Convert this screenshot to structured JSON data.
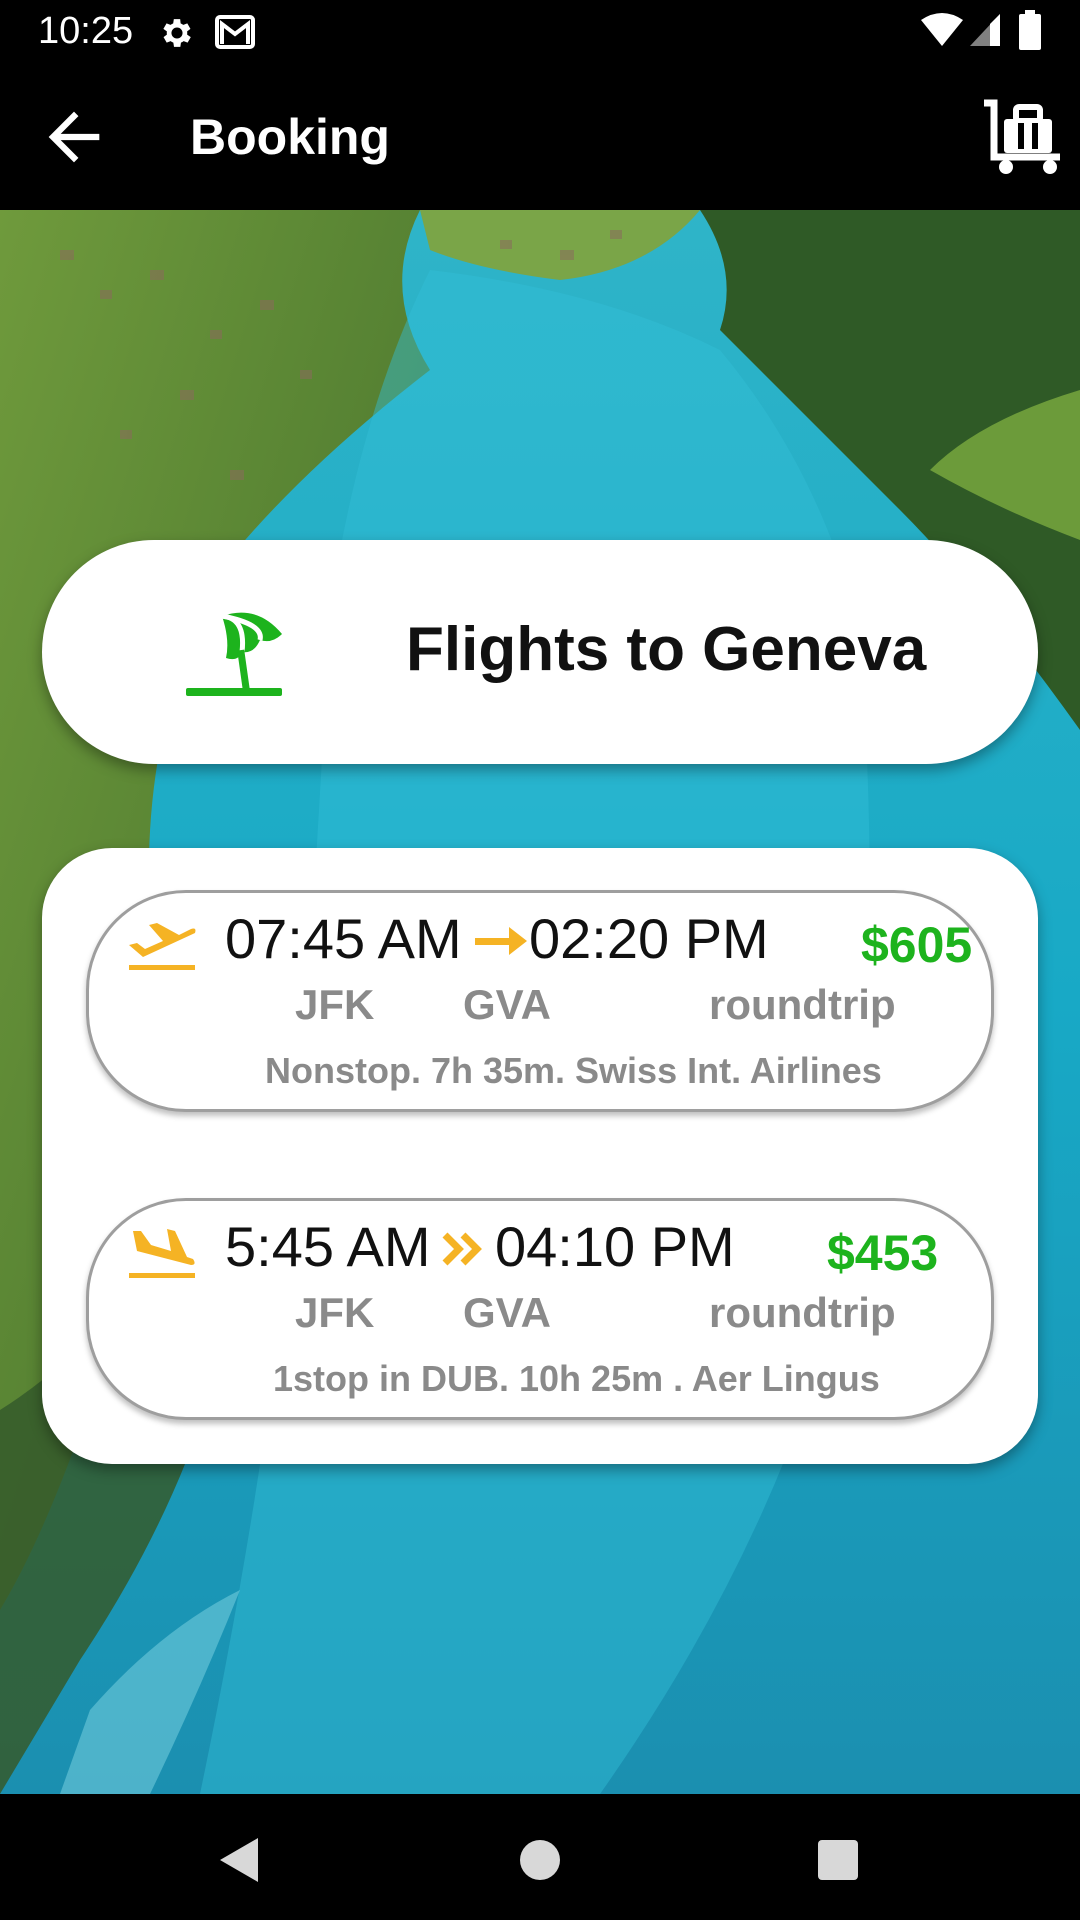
{
  "status_bar": {
    "time": "10:25",
    "icons": [
      "settings-icon",
      "gmail-icon",
      "wifi-icon",
      "signal-icon",
      "battery-icon"
    ]
  },
  "app_bar": {
    "title": "Booking",
    "back_icon": "arrow-back-icon",
    "action_icon": "luggage-cart-icon"
  },
  "header": {
    "title": "Flights to Geneva",
    "icon": "beach-umbrella-icon",
    "icon_color": "#1db31d"
  },
  "flights": [
    {
      "icon": "flight-takeoff-icon",
      "departure_time": "07:45 AM",
      "arrival_time": "02:20 PM",
      "arrow": "→",
      "price": "$605",
      "from": "JFK",
      "to": "GVA",
      "trip_type": "roundtrip",
      "details": "Nonstop. 7h 35m. Swiss Int. Airlines"
    },
    {
      "icon": "flight-land-icon",
      "departure_time": "5:45 AM",
      "arrival_time": "04:10 PM",
      "arrow": "»",
      "price": "$453",
      "from": "JFK",
      "to": "GVA",
      "trip_type": "roundtrip",
      "details": "1stop in DUB. 10h 25m . Aer Lingus"
    }
  ],
  "colors": {
    "accent_green": "#1db31d",
    "accent_orange": "#f5b324",
    "secondary_text": "#8a8a8a"
  },
  "nav_bar": {
    "buttons": [
      "back-triangle-icon",
      "home-circle-icon",
      "recents-square-icon"
    ]
  }
}
